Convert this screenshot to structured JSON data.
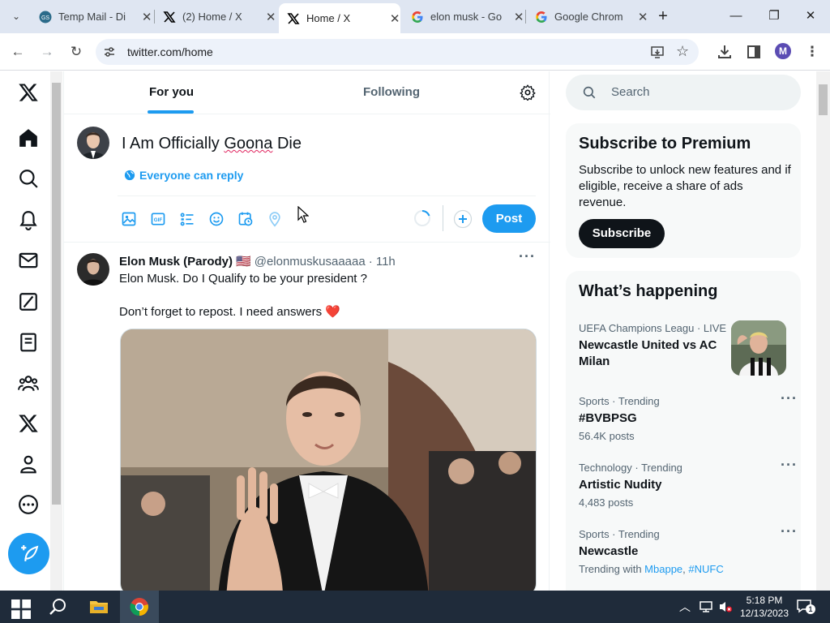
{
  "tabs": [
    {
      "title": "Temp Mail - Di",
      "icon": "tempmail-icon"
    },
    {
      "title": "(2) Home / X",
      "icon": "x-logo-icon"
    },
    {
      "title": "Home / X",
      "icon": "x-logo-icon"
    },
    {
      "title": "elon musk - Go",
      "icon": "google-icon"
    },
    {
      "title": "Google Chrom",
      "icon": "google-icon"
    }
  ],
  "address": {
    "url": "twitter.com/home"
  },
  "profile_initial": "M",
  "feed": {
    "tab_for_you": "For you",
    "tab_following": "Following"
  },
  "composer": {
    "text_before": "I Am Officially ",
    "text_misspelled": "Goona",
    "text_after": " Die",
    "reply_setting": "Everyone can reply",
    "post_label": "Post"
  },
  "tweet": {
    "name": "Elon Musk (Parody)",
    "flag": "🇺🇸",
    "handle": "@elonmuskusaaaaa",
    "time": "· 11h",
    "line1": "Elon Musk. Do I Qualify to be your president ?",
    "line2": "Don’t forget to repost. I need answers ❤️"
  },
  "sidebar": {
    "search_placeholder": "Search",
    "premium_title": "Subscribe to Premium",
    "premium_desc": "Subscribe to unlock new features and if eligible, receive a share of ads revenue.",
    "subscribe_label": "Subscribe",
    "happening_title": "What’s happening",
    "trends": [
      {
        "meta": "UEFA Champions Leagu · LIVE",
        "name": "Newcastle United vs AC Milan",
        "count": ""
      },
      {
        "meta": "Sports · Trending",
        "name": "#BVBPSG",
        "count": "56.4K posts"
      },
      {
        "meta": "Technology · Trending",
        "name": "Artistic Nudity",
        "count": "4,483 posts"
      },
      {
        "meta": "Sports · Trending",
        "name": "Newcastle",
        "count_prefix": "Trending with ",
        "link1": "Mbappe",
        "sep": ", ",
        "link2": "#NUFC"
      }
    ]
  },
  "taskbar": {
    "time": "5:18 PM",
    "date": "12/13/2023",
    "notifications": "1"
  },
  "colors": {
    "accent": "#1d9bf0",
    "text": "#0f1419",
    "muted": "#536471"
  }
}
